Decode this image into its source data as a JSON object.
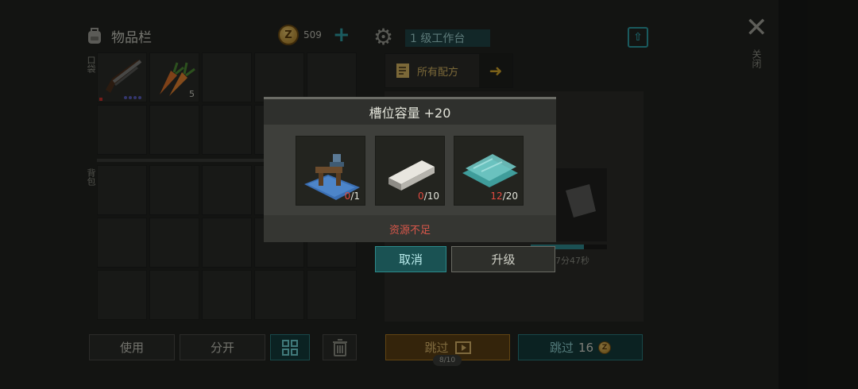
{
  "inventory": {
    "title": "物品栏",
    "coins": "509",
    "hotbar_label": "口袋",
    "backpack_label": "背包",
    "hotbar_slots": [
      {
        "item": "shotgun",
        "count": ""
      },
      {
        "item": "carrot",
        "count": "5"
      },
      {
        "item": "",
        "count": ""
      },
      {
        "item": "",
        "count": ""
      },
      {
        "item": "",
        "count": ""
      },
      {
        "item": "",
        "count": ""
      },
      {
        "item": "",
        "count": ""
      },
      {
        "item": "",
        "count": ""
      },
      {
        "item": "",
        "count": ""
      },
      {
        "item": "",
        "count": ""
      }
    ],
    "buttons": {
      "use": "使用",
      "split": "分开"
    }
  },
  "workbench": {
    "title": "1 级工作台",
    "all_recipes": "所有配方",
    "close_label": "关闭",
    "progress": 0.7,
    "timer": "17分47秒",
    "skip_ad_label": "跳过",
    "skip_ad_counter": "8/10",
    "skip_coin_label": "跳过",
    "skip_coin_cost": "16"
  },
  "modal": {
    "title": "槽位容量 +20",
    "requirements": [
      {
        "item": "workbench-kit",
        "have": "0",
        "need": "/1"
      },
      {
        "item": "metal-ingot",
        "have": "0",
        "need": "/10"
      },
      {
        "item": "glass-pane",
        "have": "12",
        "need": "/20"
      }
    ],
    "message": "资源不足",
    "cancel": "取消",
    "upgrade": "升级"
  },
  "colors": {
    "accent_teal": "#2f9fa6",
    "warning_red": "#d8574a",
    "gold": "#d4b461"
  },
  "icons": [
    "backpack-icon",
    "coin-icon",
    "plus-icon",
    "gear-icon",
    "upload-icon",
    "close-icon",
    "arrow-right-icon",
    "grid-icon",
    "trash-icon",
    "video-icon"
  ]
}
